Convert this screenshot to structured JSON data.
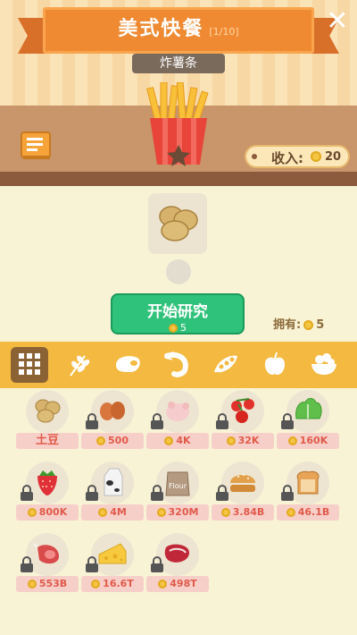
{
  "header": {
    "title": "美式快餐",
    "progress": "[1/10]",
    "subtitle": "炸薯条",
    "close_symbol": "✕"
  },
  "income": {
    "label": "收入:",
    "value": "20"
  },
  "research": {
    "item": "potato",
    "start_label": "开始研究",
    "cost": "5",
    "owned_label": "拥有:",
    "owned_value": "5"
  },
  "categories": [
    {
      "name": "grid-icon",
      "active": true
    },
    {
      "name": "wheat-icon",
      "active": false
    },
    {
      "name": "meat-icon",
      "active": false
    },
    {
      "name": "shrimp-icon",
      "active": false
    },
    {
      "name": "peas-icon",
      "active": false
    },
    {
      "name": "apple-icon",
      "active": false
    },
    {
      "name": "salad-icon",
      "active": false
    }
  ],
  "ingredients": [
    {
      "icon": "potato-icon",
      "label": "土豆",
      "locked": false
    },
    {
      "icon": "egg-icon",
      "label": "500",
      "locked": true
    },
    {
      "icon": "chicken-icon",
      "label": "4K",
      "locked": true
    },
    {
      "icon": "tomato-icon",
      "label": "32K",
      "locked": true
    },
    {
      "icon": "lettuce-icon",
      "label": "160K",
      "locked": true
    },
    {
      "icon": "strawberry-icon",
      "label": "800K",
      "locked": true
    },
    {
      "icon": "milk-icon",
      "label": "4M",
      "locked": true
    },
    {
      "icon": "flour-icon",
      "label": "320M",
      "locked": true
    },
    {
      "icon": "bun-icon",
      "label": "3.84B",
      "locked": true
    },
    {
      "icon": "bread-icon",
      "label": "46.1B",
      "locked": true
    },
    {
      "icon": "ham-icon",
      "label": "553B",
      "locked": true
    },
    {
      "icon": "cheese-icon",
      "label": "16.6T",
      "locked": true
    },
    {
      "icon": "steak-icon",
      "label": "498T",
      "locked": true
    }
  ],
  "flour_bag_text": "Flour",
  "colors": {
    "ribbon": "#ef8a32",
    "category_bar": "#f4b940",
    "start_button": "#2fc27a",
    "price_text": "#e05a4a"
  }
}
